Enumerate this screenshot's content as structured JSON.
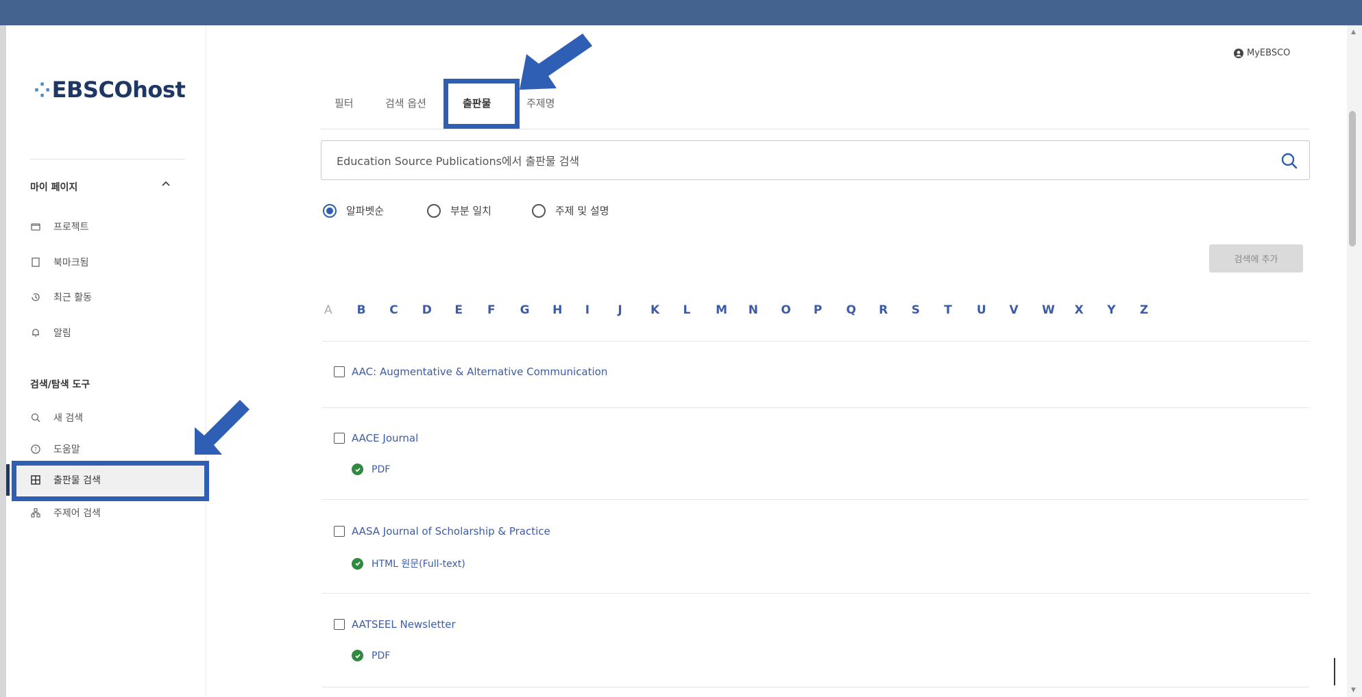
{
  "header": {
    "account": "MyEBSCO"
  },
  "sidebar": {
    "logo": "EBSCOhost",
    "section1_title": "마이 페이지",
    "section1_items": [
      {
        "label": "프로젝트",
        "icon": "folder-icon"
      },
      {
        "label": "북마크됨",
        "icon": "bookmark-icon"
      },
      {
        "label": "최근 활동",
        "icon": "history-icon"
      },
      {
        "label": "알림",
        "icon": "bell-icon"
      }
    ],
    "section2_title": "검색/탐색 도구",
    "section2_items": [
      {
        "label": "새 검색",
        "icon": "search-icon"
      },
      {
        "label": "도움말",
        "icon": "help-icon"
      },
      {
        "label": "출판물 검색",
        "icon": "publications-icon",
        "active": true
      },
      {
        "label": "주제어 검색",
        "icon": "subjects-icon"
      }
    ]
  },
  "main": {
    "tabs": [
      {
        "label": "필터"
      },
      {
        "label": "검색 옵션"
      },
      {
        "label": "출판물",
        "active": true
      },
      {
        "label": "주제명"
      }
    ],
    "search": {
      "placeholder": "Education Source Publications에서 출판물 검색"
    },
    "radio_options": [
      {
        "label": "알파벳순",
        "selected": true
      },
      {
        "label": "부분 일치",
        "selected": false
      },
      {
        "label": "주제 및 설명",
        "selected": false
      }
    ],
    "add_to_search": "검색에 추가",
    "alphabet": [
      "A",
      "B",
      "C",
      "D",
      "E",
      "F",
      "G",
      "H",
      "I",
      "J",
      "K",
      "L",
      "M",
      "N",
      "O",
      "P",
      "Q",
      "R",
      "S",
      "T",
      "U",
      "V",
      "W",
      "X",
      "Y",
      "Z"
    ],
    "publications": [
      {
        "title": "AAC: Augmentative & Alternative Communication",
        "format": ""
      },
      {
        "title": "AACE Journal",
        "format": "PDF"
      },
      {
        "title": "AASA Journal of Scholarship & Practice",
        "format": "HTML 원문(Full-text)"
      },
      {
        "title": "AATSEEL Newsletter",
        "format": "PDF"
      }
    ]
  },
  "colors": {
    "topbar": "#44638f",
    "accent": "#3b5ba7",
    "highlight_annotation": "#2f5fb5",
    "fulltext_check": "#2e8b3d"
  }
}
